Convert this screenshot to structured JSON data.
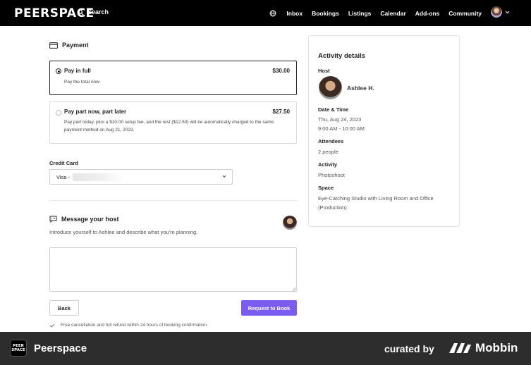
{
  "nav": {
    "logo": "PEERSPACE",
    "search_label": "Search",
    "items": [
      "Inbox",
      "Bookings",
      "Listings",
      "Calendar",
      "Add-ons",
      "Community"
    ]
  },
  "payment": {
    "title": "Payment",
    "options": [
      {
        "title": "Pay in full",
        "price": "$30.00",
        "desc": "Pay the total now.",
        "selected": true
      },
      {
        "title": "Pay part now, part later",
        "price": "$27.50",
        "desc_line1": "Pay part today, plus a $10.00 setup fee, and the rest ($12.50) will be automatically charged to the same",
        "desc_line2": "payment method on Aug 21, 2023.",
        "selected": false
      }
    ]
  },
  "credit_card": {
    "label": "Credit Card",
    "value": "Visa -"
  },
  "message": {
    "title": "Message your host",
    "subtitle": "Introduce yourself to Ashlee and describe what you're planning."
  },
  "actions": {
    "back": "Back",
    "request": "Request to Book",
    "cancel_note": "Free cancellation and full refund within 24 hours of booking confirmation."
  },
  "activity": {
    "title": "Activity details",
    "host_label": "Host",
    "host_name": "Ashlee H.",
    "datetime_label": "Date & Time",
    "date": "Thu, Aug 24, 2023",
    "time": "9:00 AM - 10:00 AM",
    "attendees_label": "Attendees",
    "attendees": "2 people",
    "activity_label": "Activity",
    "activity": "Photoshoot",
    "space_label": "Space",
    "space_line1": "Eye-Catching Studio with Living Room and Office",
    "space_line2": "(Production)"
  },
  "footer": {
    "logo_text": "PEER SPACE",
    "brand": "Peerspace",
    "curated": "curated by",
    "mobbin": "Mobbin"
  },
  "colors": {
    "accent": "#7b5cf0",
    "nav_bg": "#000000",
    "footer_bg": "#2d2d2d"
  }
}
